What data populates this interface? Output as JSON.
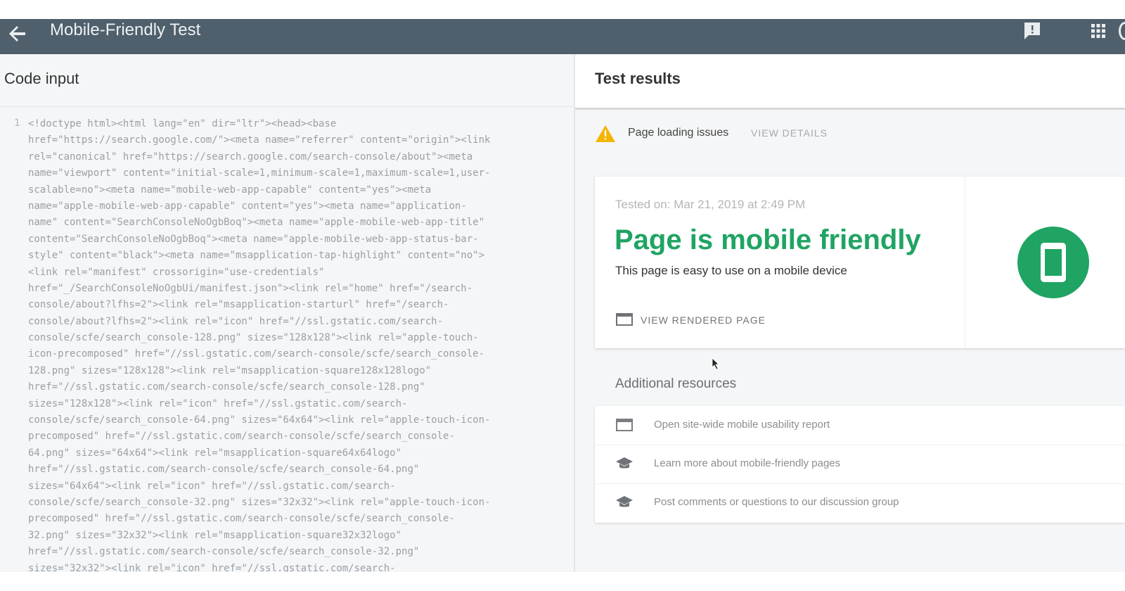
{
  "header": {
    "title": "Mobile-Friendly Test",
    "back_icon": "arrow-back-icon",
    "feedback_icon": "feedback-icon",
    "apps_icon": "apps-grid-icon",
    "bg_color": "#4f5f6c"
  },
  "left_panel": {
    "title": "Code input",
    "line_number": "1",
    "code_lines": [
      "<!doctype html><html lang=\"en\" dir=\"ltr\"><head><base",
      "href=\"https://search.google.com/\"><meta name=\"referrer\" content=\"origin\"><link",
      "rel=\"canonical\" href=\"https://search.google.com/search-console/about\"><meta",
      "name=\"viewport\" content=\"initial-scale=1,minimum-scale=1,maximum-scale=1,user-",
      "scalable=no\"><meta name=\"mobile-web-app-capable\" content=\"yes\"><meta",
      "name=\"apple-mobile-web-app-capable\" content=\"yes\"><meta name=\"application-",
      "name\" content=\"SearchConsoleNoOgbBoq\"><meta name=\"apple-mobile-web-app-title\"",
      "content=\"SearchConsoleNoOgbBoq\"><meta name=\"apple-mobile-web-app-status-bar-",
      "style\" content=\"black\"><meta name=\"msapplication-tap-highlight\" content=\"no\">",
      "<link rel=\"manifest\" crossorigin=\"use-credentials\"",
      "href=\"_/SearchConsoleNoOgbUi/manifest.json\"><link rel=\"home\" href=\"/search-",
      "console/about?lfhs=2\"><link rel=\"msapplication-starturl\" href=\"/search-",
      "console/about?lfhs=2\"><link rel=\"icon\" href=\"//ssl.gstatic.com/search-",
      "console/scfe/search_console-128.png\" sizes=\"128x128\"><link rel=\"apple-touch-",
      "icon-precomposed\" href=\"//ssl.gstatic.com/search-console/scfe/search_console-",
      "128.png\" sizes=\"128x128\"><link rel=\"msapplication-square128x128logo\"",
      "href=\"//ssl.gstatic.com/search-console/scfe/search_console-128.png\"",
      "sizes=\"128x128\"><link rel=\"icon\" href=\"//ssl.gstatic.com/search-",
      "console/scfe/search_console-64.png\" sizes=\"64x64\"><link rel=\"apple-touch-icon-",
      "precomposed\" href=\"//ssl.gstatic.com/search-console/scfe/search_console-",
      "64.png\" sizes=\"64x64\"><link rel=\"msapplication-square64x64logo\"",
      "href=\"//ssl.gstatic.com/search-console/scfe/search_console-64.png\"",
      "sizes=\"64x64\"><link rel=\"icon\" href=\"//ssl.gstatic.com/search-",
      "console/scfe/search_console-32.png\" sizes=\"32x32\"><link rel=\"apple-touch-icon-",
      "precomposed\" href=\"//ssl.gstatic.com/search-console/scfe/search_console-",
      "32.png\" sizes=\"32x32\"><link rel=\"msapplication-square32x32logo\"",
      "href=\"//ssl.gstatic.com/search-console/scfe/search_console-32.png\"",
      "sizes=\"32x32\"><link rel=\"icon\" href=\"//ssl.gstatic.com/search-"
    ]
  },
  "right_panel": {
    "title": "Test results",
    "issues": {
      "icon": "warning-icon",
      "label": "Page loading issues",
      "action": "VIEW DETAILS"
    },
    "result": {
      "tested_on": "Tested on: Mar 21, 2019 at 2:49 PM",
      "verdict": "Page is mobile friendly",
      "subtitle": "This page is easy to use on a mobile device",
      "view_rendered": "VIEW RENDERED PAGE",
      "verdict_color": "#1fa463",
      "badge_icon": "mobile-phone-icon"
    },
    "resources": {
      "title": "Additional resources",
      "items": [
        {
          "icon": "report-window-icon",
          "label": "Open site-wide mobile usability report"
        },
        {
          "icon": "graduation-cap-icon",
          "label": "Learn more about mobile-friendly pages"
        },
        {
          "icon": "graduation-cap-icon",
          "label": "Post comments or questions to our discussion group"
        }
      ]
    }
  }
}
